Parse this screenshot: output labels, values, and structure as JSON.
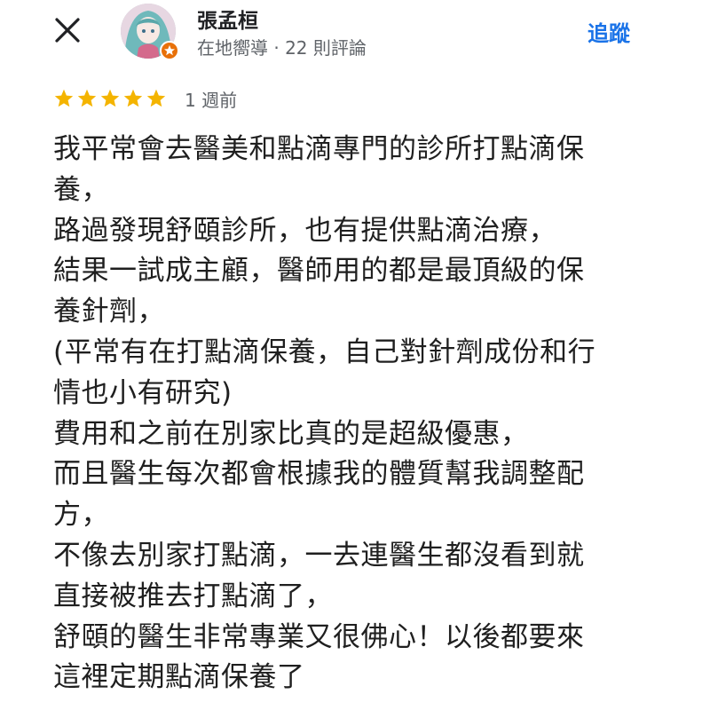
{
  "header": {
    "close_icon": "close-icon",
    "reviewer": {
      "name": "張孟桓",
      "meta": "在地嚮導 · 22 則評論",
      "avatar_icon": "avatar-image",
      "badge_icon": "local-guide-badge-icon"
    },
    "follow_label": "追蹤"
  },
  "rating": {
    "stars": 5,
    "max_stars": 5,
    "star_color": "#f4b400",
    "time": "1 週前"
  },
  "review": {
    "lines": [
      "我平常會去醫美和點滴專門的診所打點滴保",
      "養，",
      "路過發現舒頤診所，也有提供點滴治療，",
      "結果一試成主顧，醫師用的都是最頂級的保",
      "養針劑，",
      "(平常有在打點滴保養，自己對針劑成份和行",
      "情也小有研究)",
      "費用和之前在別家比真的是超級優惠，",
      "而且醫生每次都會根據我的體質幫我調整配",
      "方，",
      "不像去別家打點滴，一去連醫生都沒看到就",
      "直接被推去打點滴了，",
      "舒頤的醫生非常專業又很佛心！以後都要來",
      "這裡定期點滴保養了"
    ]
  },
  "colors": {
    "accent": "#1a73e8",
    "secondary_text": "#5f6368",
    "badge": "#e8710a"
  }
}
